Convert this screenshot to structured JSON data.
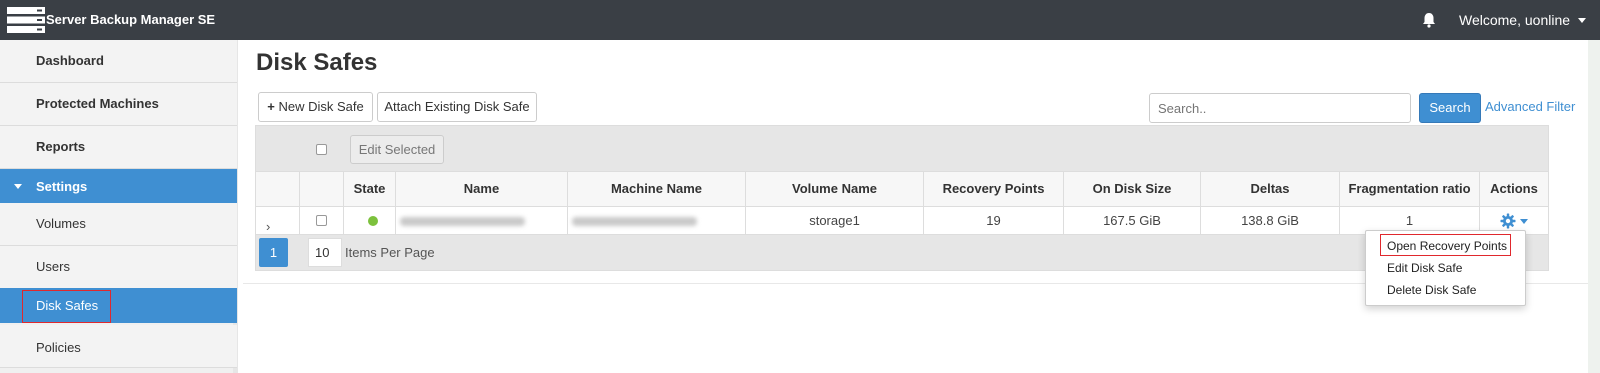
{
  "app": {
    "title": "Server Backup Manager SE",
    "welcome": "Welcome, uonline"
  },
  "sidebar": {
    "items": [
      {
        "label": "Dashboard"
      },
      {
        "label": "Protected Machines"
      },
      {
        "label": "Reports"
      },
      {
        "label": "Settings",
        "expanded": true
      },
      {
        "label": "Volumes"
      },
      {
        "label": "Users"
      },
      {
        "label": "Disk Safes",
        "selected": true
      },
      {
        "label": "Policies"
      }
    ]
  },
  "main": {
    "title": "Disk Safes",
    "new_button": "New Disk Safe",
    "attach_button": "Attach Existing Disk Safe",
    "search_placeholder": "Search..",
    "search_button": "Search",
    "advanced_filter": "Advanced Filter",
    "edit_selected": "Edit Selected"
  },
  "table": {
    "columns": [
      "State",
      "Name",
      "Machine Name",
      "Volume Name",
      "Recovery Points",
      "On Disk Size",
      "Deltas",
      "Fragmentation ratio",
      "Actions"
    ],
    "rows": [
      {
        "state": "online",
        "name": "(blurred)",
        "machine_name": "(blurred)",
        "volume_name": "storage1",
        "recovery_points": "19",
        "on_disk_size": "167.5 GiB",
        "deltas": "138.8 GiB",
        "fragmentation_ratio": "1"
      }
    ],
    "pagination": {
      "current_page": "1",
      "items_per_page": "10",
      "items_per_page_label": "Items Per Page"
    }
  },
  "actions_menu": {
    "items": [
      "Open Recovery Points",
      "Edit Disk Safe",
      "Delete Disk Safe"
    ]
  },
  "colors": {
    "topbar": "#3a3f45",
    "accent": "#3f8fd2",
    "state_online": "#7cc13c",
    "highlight": "#e0282d"
  }
}
